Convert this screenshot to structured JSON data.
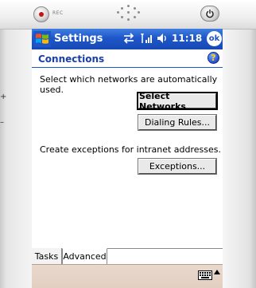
{
  "device": {
    "rec_label": "REC",
    "left_marks": [
      "+",
      "–"
    ]
  },
  "titlebar": {
    "title": "Settings",
    "time": "11:18",
    "ok_label": "ok"
  },
  "header": {
    "title": "Connections",
    "help_glyph": "?"
  },
  "content": {
    "networks_text": "Select which networks are automatically used.",
    "select_networks_label": "Select Networks",
    "dialing_rules_label": "Dialing Rules...",
    "exceptions_text": "Create exceptions for intranet addresses.",
    "exceptions_label": "Exceptions..."
  },
  "tabs": [
    {
      "label": "Tasks",
      "active": false
    },
    {
      "label": "Advanced",
      "active": true
    }
  ],
  "icons": {
    "start": "windows-flag-icon",
    "sync": "sync-icon",
    "signal": "signal-icon",
    "volume": "volume-icon",
    "keyboard": "keyboard-icon"
  }
}
